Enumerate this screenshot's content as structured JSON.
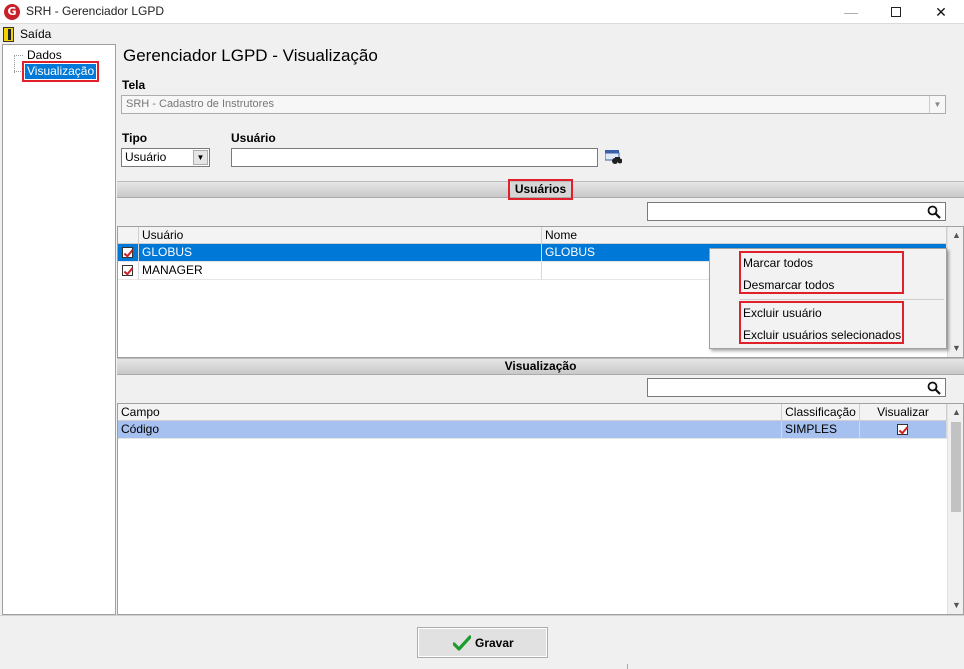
{
  "window": {
    "title": "SRH - Gerenciador LGPD",
    "logo_letter": "G",
    "min_glyph": "—",
    "close_glyph": "✕"
  },
  "menu": {
    "exit_label": "Saída"
  },
  "tree": {
    "items": [
      "Dados",
      "Visualização"
    ]
  },
  "page": {
    "title": "Gerenciador LGPD - Visualização"
  },
  "form": {
    "tela_label": "Tela",
    "tela_value": "SRH - Cadastro de Instrutores",
    "tipo_label": "Tipo",
    "tipo_value": "Usuário",
    "usuario_label": "Usuário",
    "usuario_value": ""
  },
  "users_section": {
    "title": "Usuários",
    "search_value": "",
    "columns": [
      "Usuário",
      "Nome"
    ],
    "rows": [
      {
        "usuario": "GLOBUS",
        "nome": "GLOBUS",
        "checked": true
      },
      {
        "usuario": "MANAGER",
        "nome": "",
        "checked": true
      }
    ]
  },
  "context_menu": {
    "items": [
      "Marcar todos",
      "Desmarcar todos",
      "Excluir usuário",
      "Excluir usuários selecionados"
    ]
  },
  "view_section": {
    "title": "Visualização",
    "search_value": "",
    "columns": [
      "Campo",
      "Classificação",
      "Visualizar"
    ],
    "rows": [
      {
        "campo": "Código",
        "classificacao": "SIMPLES",
        "visualizar": true
      }
    ]
  },
  "footer": {
    "save_label": "Gravar"
  },
  "colors": {
    "selection_blue": "#0078d7",
    "selection_light": "#a6c0ef",
    "highlight_red": "#e0202a",
    "check_red": "#d02020"
  }
}
